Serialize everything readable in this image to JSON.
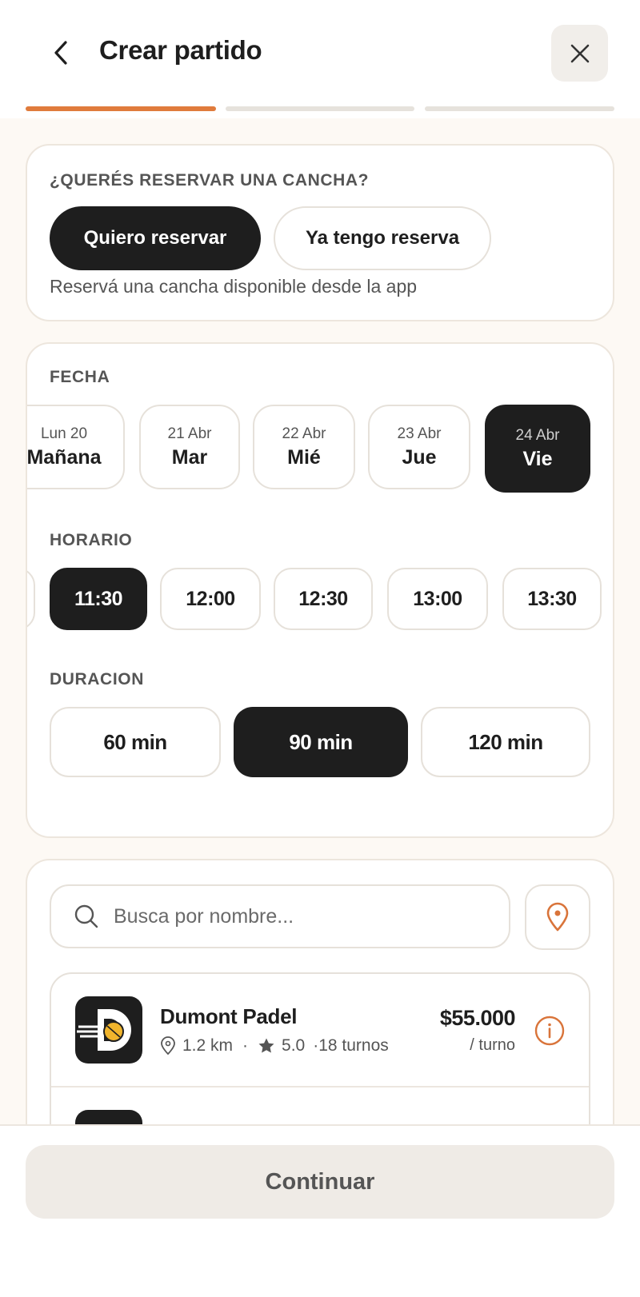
{
  "header": {
    "title": "Crear partido",
    "back_icon": "chevron-left-icon",
    "close_icon": "close-icon",
    "progress_steps": 3,
    "progress_current": 1,
    "accent_color": "#e07b3c"
  },
  "reservation": {
    "question": "¿QUERÉS RESERVAR UNA CANCHA?",
    "options": [
      {
        "label": "Quiero reservar",
        "selected": true
      },
      {
        "label": "Ya tengo reserva",
        "selected": false
      }
    ],
    "helper": "Reservá una cancha disponible desde la app"
  },
  "date": {
    "label": "FECHA",
    "options": [
      {
        "small": "Lun 20",
        "big": "Mañana",
        "selected": false
      },
      {
        "small": "21 Abr",
        "big": "Mar",
        "selected": false
      },
      {
        "small": "22 Abr",
        "big": "Mié",
        "selected": false
      },
      {
        "small": "23 Abr",
        "big": "Jue",
        "selected": false
      },
      {
        "small": "24 Abr",
        "big": "Vie",
        "selected": true
      }
    ]
  },
  "time": {
    "label": "HORARIO",
    "options": [
      {
        "label": "",
        "selected": false
      },
      {
        "label": "11:30",
        "selected": true
      },
      {
        "label": "12:00",
        "selected": false
      },
      {
        "label": "12:30",
        "selected": false
      },
      {
        "label": "13:00",
        "selected": false
      },
      {
        "label": "13:30",
        "selected": false
      }
    ]
  },
  "duration": {
    "label": "DURACION",
    "options": [
      {
        "label": "60 min",
        "selected": false
      },
      {
        "label": "90 min",
        "selected": true
      },
      {
        "label": "120 min",
        "selected": false
      }
    ]
  },
  "search": {
    "placeholder": "Busca por nombre...",
    "search_icon": "search-icon",
    "location_icon": "location-pin-icon"
  },
  "venues": [
    {
      "name": "Dumont Padel",
      "distance": "1.2 km",
      "rating": "5.0",
      "slots": "·18 turnos",
      "price": "$55.000",
      "unit": "/ turno"
    }
  ],
  "footer": {
    "continue_label": "Continuar"
  }
}
